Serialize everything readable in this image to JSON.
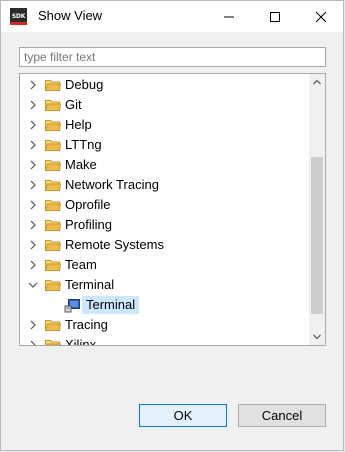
{
  "window": {
    "title": "Show View",
    "app_icon_text": "SDK"
  },
  "filter": {
    "placeholder": "type filter text",
    "value": ""
  },
  "tree": {
    "items": [
      {
        "label": "Debug",
        "expanded": false
      },
      {
        "label": "Git",
        "expanded": false
      },
      {
        "label": "Help",
        "expanded": false
      },
      {
        "label": "LTTng",
        "expanded": false
      },
      {
        "label": "Make",
        "expanded": false
      },
      {
        "label": "Network Tracing",
        "expanded": false
      },
      {
        "label": "Oprofile",
        "expanded": false
      },
      {
        "label": "Profiling",
        "expanded": false
      },
      {
        "label": "Remote Systems",
        "expanded": false
      },
      {
        "label": "Team",
        "expanded": false
      },
      {
        "label": "Terminal",
        "expanded": true
      },
      {
        "label": "Terminal",
        "child": true,
        "selected": true
      },
      {
        "label": "Tracing",
        "expanded": false
      },
      {
        "label": "Xilinx",
        "expanded": false
      }
    ]
  },
  "buttons": {
    "ok_label": "OK",
    "cancel_label": "Cancel"
  },
  "colors": {
    "selection": "#cce8ff",
    "folder": "#e8b64a",
    "default_button_border": "#0078d7"
  },
  "icons": {
    "app": "sdk-app-icon",
    "folder": "folder-icon",
    "view": "terminal-view-icon",
    "expand": "chevron-right-icon",
    "collapse": "chevron-down-icon"
  }
}
